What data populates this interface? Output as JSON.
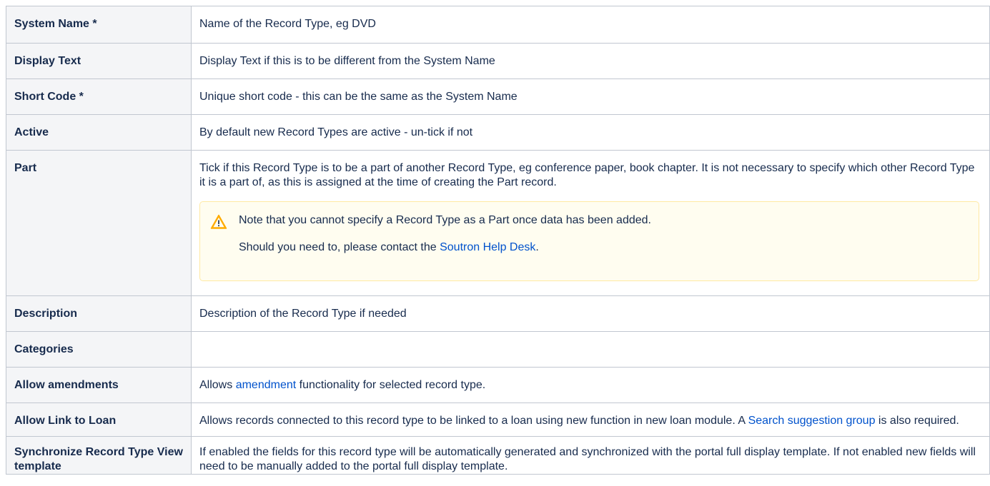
{
  "rows": {
    "system_name": {
      "label": "System Name *",
      "desc": "Name of the Record Type, eg DVD"
    },
    "display_text": {
      "label": "Display Text",
      "desc": "Display Text if this is to be different from the System Name"
    },
    "short_code": {
      "label": "Short Code *",
      "desc": "Unique short code - this can be the same as the System Name"
    },
    "active": {
      "label": "Active",
      "desc": "By default new Record Types are active - un-tick if not"
    },
    "part": {
      "label": "Part",
      "desc": "Tick if this Record Type is to be a part of another Record Type, eg conference paper, book chapter. It is not necessary to specify which other Record Type it is a part of, as this is assigned at the time of creating the Part record.",
      "note": {
        "icon": "warning-icon",
        "line1": "Note that you cannot specify a Record Type as a Part once data has been added.",
        "line2_before": "Should you need to, please contact the ",
        "line2_link": "Soutron Help Desk",
        "line2_after": "."
      }
    },
    "description": {
      "label": "Description",
      "desc": "Description of the Record Type if needed"
    },
    "categories": {
      "label": "Categories",
      "desc": ""
    },
    "allow_amendments": {
      "label": "Allow amendments",
      "desc_before": "Allows ",
      "desc_link": "amendment",
      "desc_after": " functionality for selected record type."
    },
    "allow_link_loan": {
      "label": "Allow Link to Loan",
      "desc_before": "Allows records connected to this record type to be linked to a loan using new function in new loan module. A ",
      "desc_link": "Search suggestion group",
      "desc_after": " is also required."
    },
    "synchronize": {
      "label": "Synchronize Record Type View template",
      "desc": "If enabled the fields for this record type will be automatically generated and synchronized with the portal full display template. If not enabled new fields will need to be manually added to the portal full display template."
    }
  },
  "colors": {
    "header_bg": "#f4f5f7",
    "border": "#c1c7d0",
    "link": "#0052cc",
    "note_bg": "#fffdf0",
    "note_border": "#ffe9a3",
    "warning": "#ffab00"
  }
}
